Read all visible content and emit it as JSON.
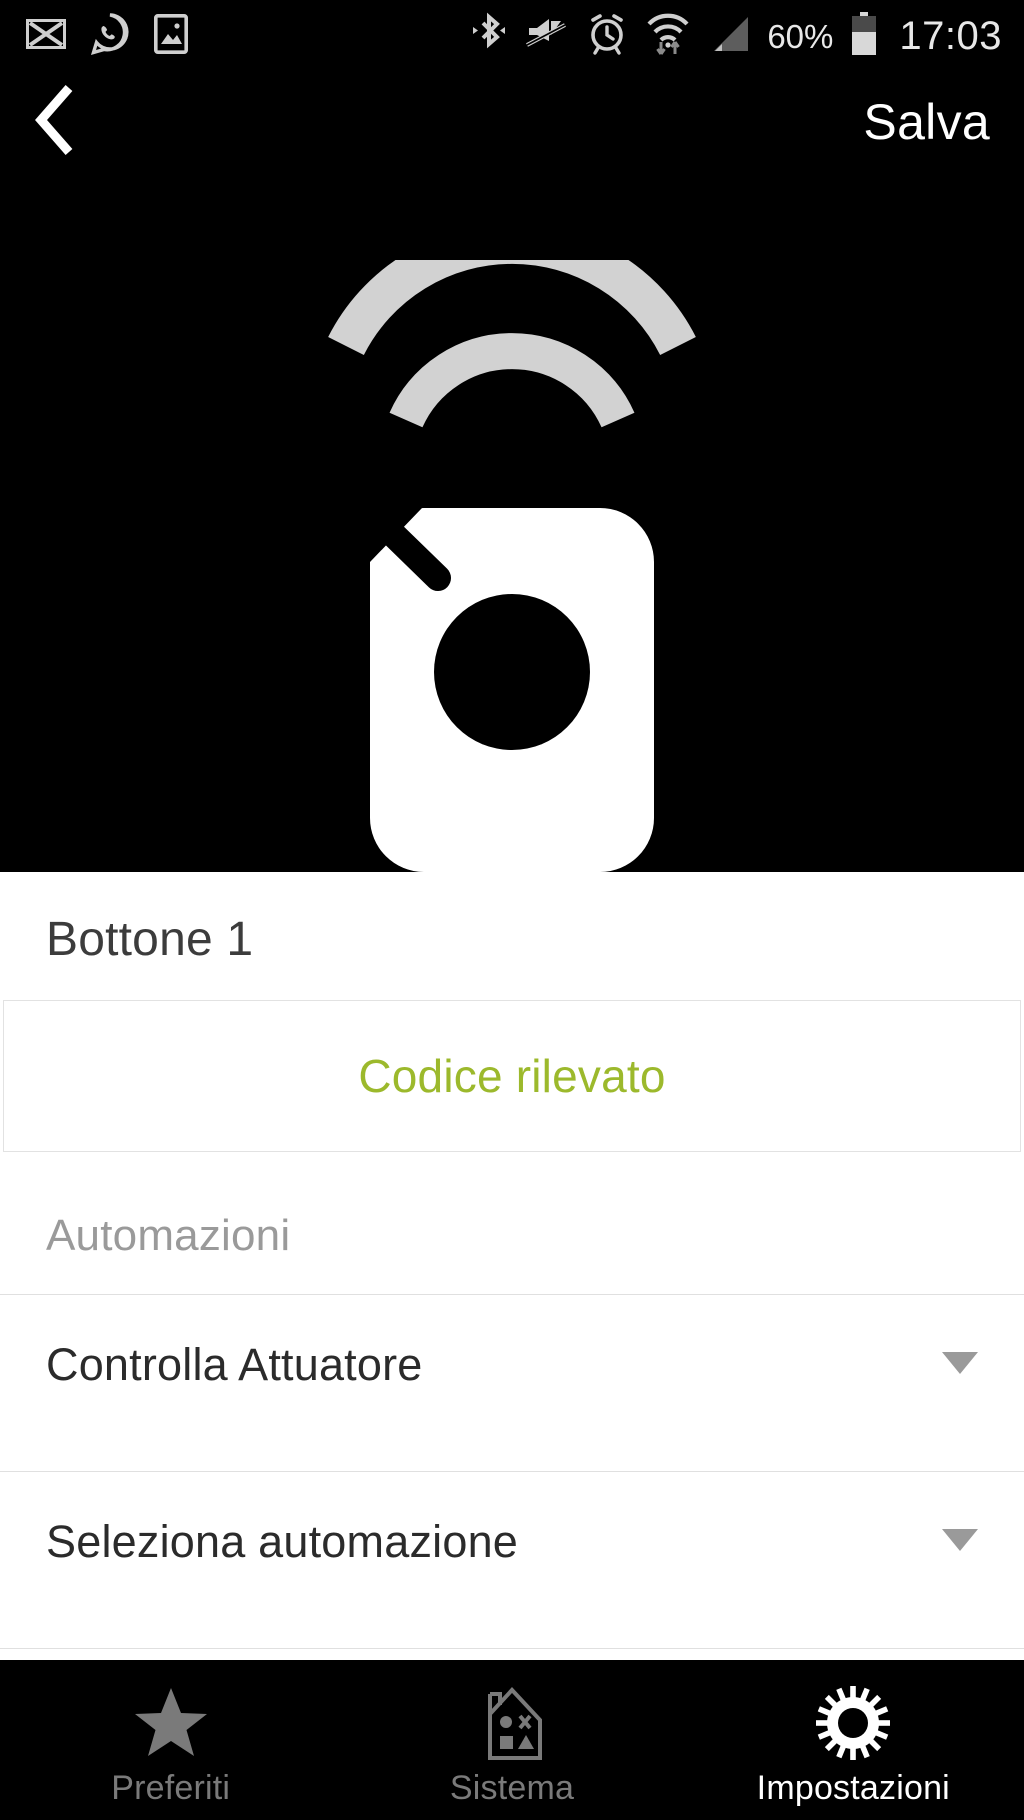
{
  "status_bar": {
    "time": "17:03",
    "battery_percent": "60%",
    "left_icons": [
      "mail-icon",
      "whatsapp-icon",
      "gallery-icon"
    ],
    "right_icons": [
      "bluetooth-icon",
      "mute-icon",
      "alarm-icon",
      "wifi-icon",
      "cellular-signal-icon",
      "battery-icon"
    ]
  },
  "nav_bar": {
    "back_icon": "chevron-left-icon",
    "save_label": "Salva"
  },
  "hero": {
    "icon": "wireless-remote-icon",
    "background_color": "#000000",
    "remote_color": "#ffffff",
    "signal_color": "#d2d2d2"
  },
  "main": {
    "device_title": "Bottone 1",
    "code_card": {
      "label": "Codice rilevato",
      "color": "#9cb92c"
    },
    "section_label": "Automazioni",
    "rows": [
      {
        "label": "Controlla Attuatore",
        "caret_icon": "chevron-down-icon"
      },
      {
        "label": "Seleziona automazione",
        "caret_icon": "chevron-down-icon"
      }
    ]
  },
  "tab_bar": {
    "tabs": [
      {
        "label": "Preferiti",
        "icon": "star-icon",
        "active": false
      },
      {
        "label": "Sistema",
        "icon": "house-icon",
        "active": false
      },
      {
        "label": "Impostazioni",
        "icon": "gear-icon",
        "active": true
      }
    ]
  }
}
